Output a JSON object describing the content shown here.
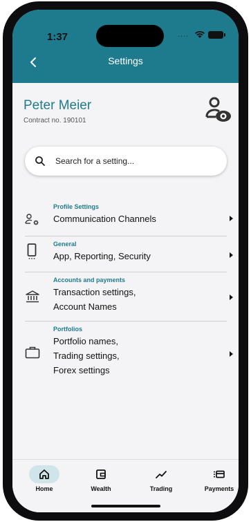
{
  "status_bar": {
    "time": "1:37",
    "signal": "...."
  },
  "header": {
    "title": "Settings"
  },
  "user": {
    "name": "Peter Meier",
    "contract": "Contract no. 190101"
  },
  "search": {
    "placeholder": "Search for a setting..."
  },
  "settings": [
    {
      "category": "Profile Settings",
      "lines": [
        "Communication Channels"
      ],
      "icon": "profile-settings-icon"
    },
    {
      "category": "General",
      "lines": [
        "App, Reporting, Security"
      ],
      "icon": "smartphone-icon"
    },
    {
      "category": "Accounts and payments",
      "lines": [
        "Transaction settings,",
        "Account Names"
      ],
      "icon": "bank-icon"
    },
    {
      "category": "Portfolios",
      "lines": [
        "Portfolio names,",
        "Trading settings,",
        "Forex settings"
      ],
      "icon": "briefcase-icon"
    }
  ],
  "tabs": [
    {
      "label": "Home",
      "icon": "home-icon",
      "active": true
    },
    {
      "label": "Wealth",
      "icon": "wallet-icon",
      "active": false
    },
    {
      "label": "Trading",
      "icon": "trend-icon",
      "active": false
    },
    {
      "label": "Payments",
      "icon": "payments-icon",
      "active": false
    }
  ],
  "colors": {
    "accent": "#1e7b8e",
    "active_tab_bg": "#cfe5ea",
    "background": "#f4f4f6"
  }
}
